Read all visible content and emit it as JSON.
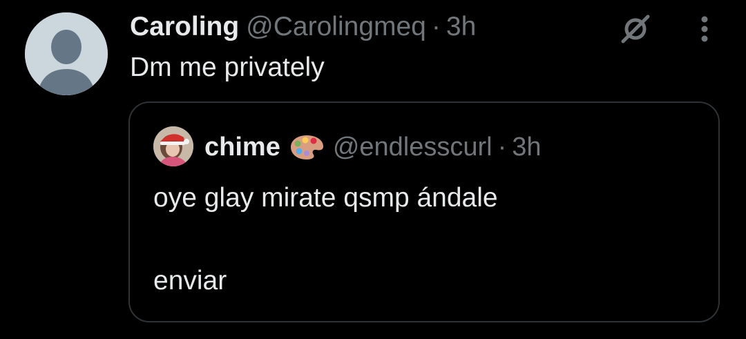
{
  "tweet": {
    "display_name": "Caroling",
    "handle": "@Carolingmeq",
    "separator": "·",
    "time": "3h",
    "text": "Dm me privately",
    "avatar_icon": "default-avatar-icon",
    "grok_icon": "grok-icon",
    "more_icon": "more-vertical-icon"
  },
  "quoted": {
    "display_name": "chime",
    "name_emoji_icon": "artist-palette-icon",
    "handle": "@endlesscurl",
    "separator": "·",
    "time": "3h",
    "text_line1": "oye glay mirate qsmp ándale",
    "text_line2": "enviar"
  },
  "colors": {
    "background": "#000000",
    "primary_text": "#e7e9ea",
    "secondary_text": "#71767b",
    "border": "#2f3336",
    "default_avatar_bg": "#ccd6dd",
    "default_avatar_fg": "#657786"
  }
}
